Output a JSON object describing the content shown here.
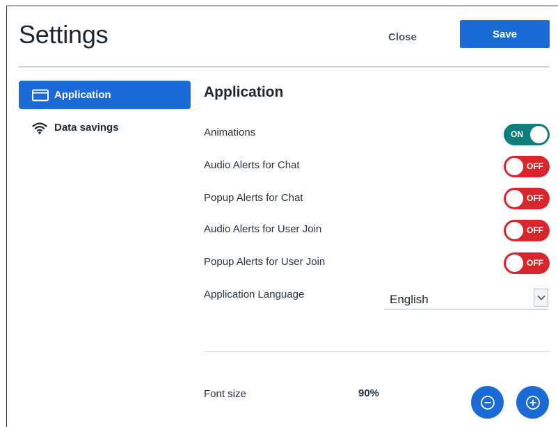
{
  "header": {
    "title": "Settings",
    "close_label": "Close",
    "save_label": "Save"
  },
  "sidebar": {
    "items": [
      {
        "label": "Application",
        "icon": "application-window-icon",
        "active": true
      },
      {
        "label": "Data savings",
        "icon": "wifi-icon",
        "active": false
      }
    ]
  },
  "main": {
    "section_title": "Application",
    "settings": [
      {
        "label": "Animations",
        "state": "ON"
      },
      {
        "label": "Audio Alerts for Chat",
        "state": "OFF"
      },
      {
        "label": "Popup Alerts for Chat",
        "state": "OFF"
      },
      {
        "label": "Audio Alerts for User Join",
        "state": "OFF"
      },
      {
        "label": "Popup Alerts for User Join",
        "state": "OFF"
      }
    ],
    "language": {
      "label": "Application Language",
      "value": "English"
    },
    "font_size": {
      "label": "Font size",
      "value": "90%",
      "decrease_icon": "minus-circle-icon",
      "increase_icon": "plus-circle-icon"
    }
  },
  "colors": {
    "accent": "#1b6bd6",
    "toggle_on": "#0f7f7d",
    "toggle_off": "#d8262c"
  }
}
